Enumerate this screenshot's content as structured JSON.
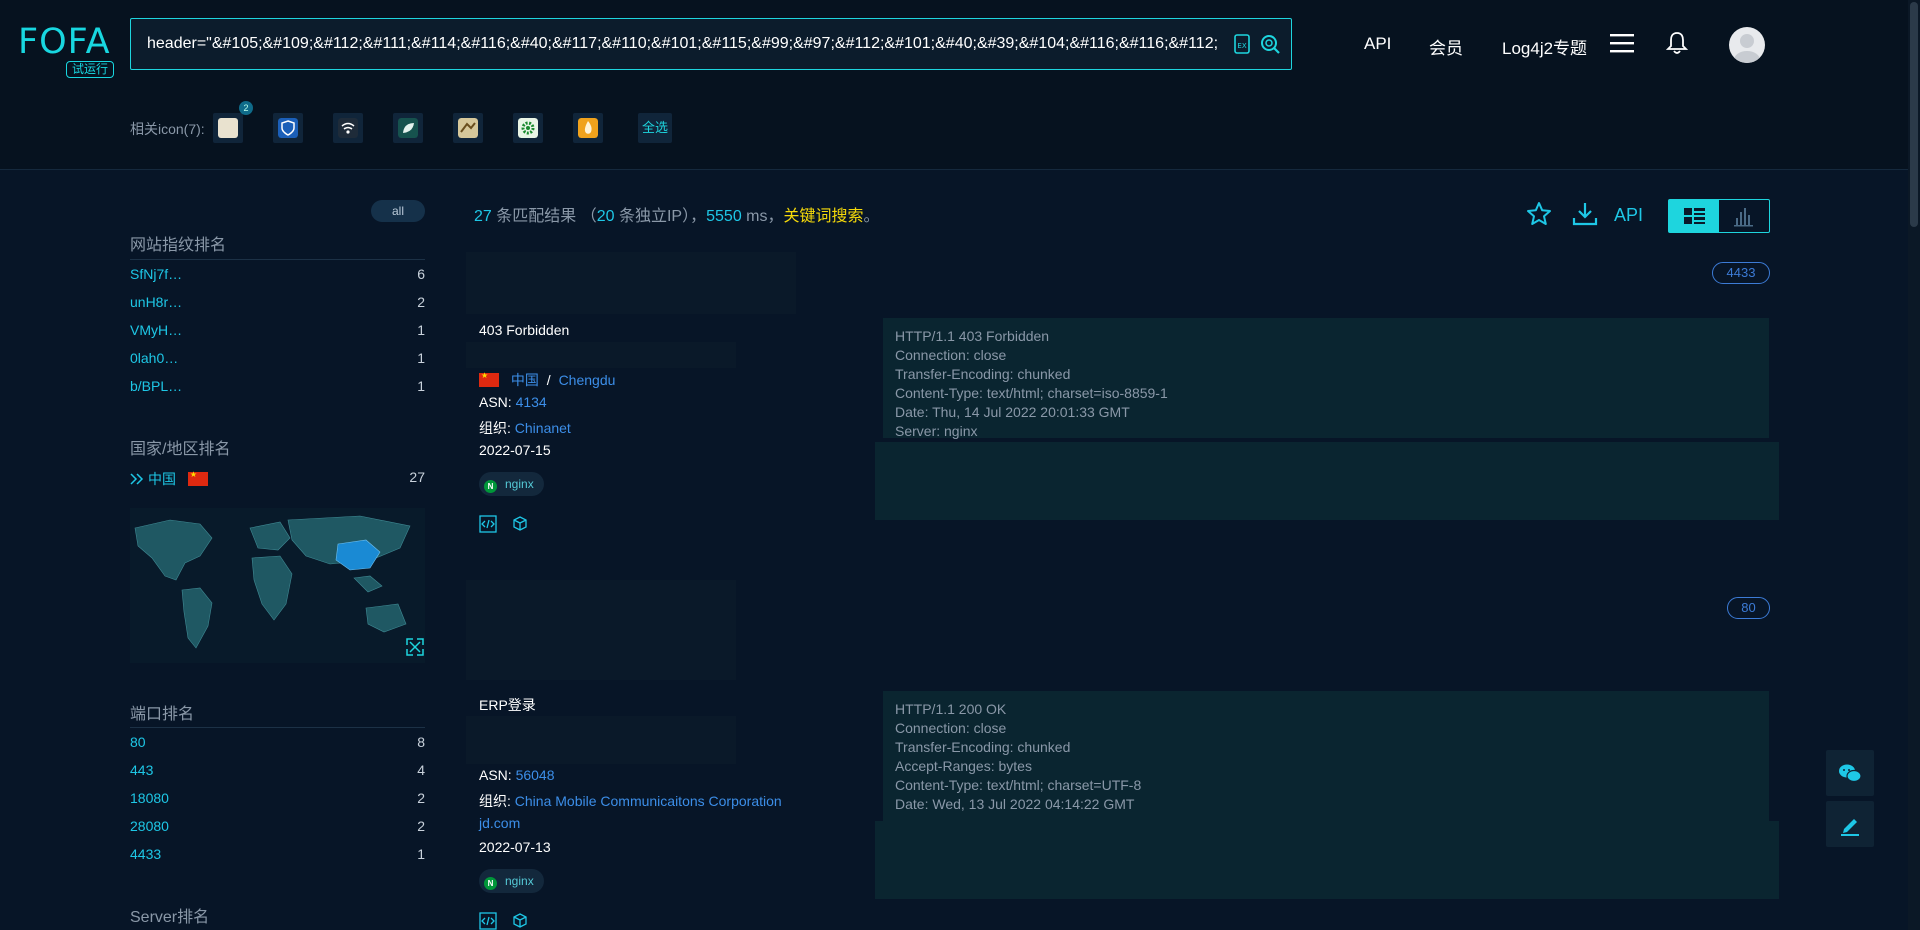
{
  "brand": {
    "name": "FOFA",
    "badge": "试运行"
  },
  "search": {
    "query": "header=\"&#105;&#109;&#112;&#111;&#114;&#116;&#40;&#117;&#110;&#101;&#115;&#99;&#97;&#112;&#101;&#40;&#39;&#104;&#116;&#116;&#112;\""
  },
  "nav": {
    "api": "API",
    "member": "会员",
    "topic": "Log4j2专题"
  },
  "related_icons": {
    "label": "相关icon(7):",
    "first_badge": "2",
    "select_all": "全选",
    "icons": [
      "pmsa-icon",
      "shield-app-icon",
      "router-icon",
      "leaf-app-icon",
      "camera-app-icon",
      "gear-green-icon",
      "fire-app-icon"
    ]
  },
  "sidebar": {
    "all_label": "all",
    "fingerprint": {
      "title": "网站指纹排名",
      "items": [
        {
          "name": "SfNj7f…",
          "count": "6"
        },
        {
          "name": "unH8r…",
          "count": "2"
        },
        {
          "name": "VMyH…",
          "count": "1"
        },
        {
          "name": "0lah0…",
          "count": "1"
        },
        {
          "name": "b/BPL…",
          "count": "1"
        }
      ]
    },
    "country": {
      "title": "国家/地区排名",
      "name": "中国",
      "count": "27"
    },
    "port": {
      "title": "端口排名",
      "items": [
        {
          "name": "80",
          "count": "8"
        },
        {
          "name": "443",
          "count": "4"
        },
        {
          "name": "18080",
          "count": "2"
        },
        {
          "name": "28080",
          "count": "2"
        },
        {
          "name": "4433",
          "count": "1"
        }
      ]
    },
    "server": {
      "title": "Server排名"
    }
  },
  "summary": {
    "results": "27",
    "results_label": "条匹配结果",
    "paren_open": "（",
    "ips": "20",
    "ips_label": "条独立IP）",
    "sep": "，",
    "ms": "5550",
    "ms_label": "ms，",
    "keyword": "关键词搜索",
    "end": "。"
  },
  "toolbar": {
    "api_label": "API"
  },
  "results": [
    {
      "port": "4433",
      "title": "403 Forbidden",
      "country": "中国",
      "slash": "/",
      "city": "Chengdu",
      "asn_label": "ASN:",
      "asn": "4134",
      "org_label": "组织:",
      "org": "Chinanet",
      "date": "2022-07-15",
      "tag": "nginx",
      "response": "HTTP/1.1 403 Forbidden\nConnection: close\nTransfer-Encoding: chunked\nContent-Type: text/html; charset=iso-8859-1\nDate: Thu, 14 Jul 2022 20:01:33 GMT\nServer: nginx"
    },
    {
      "port": "80",
      "title": "ERP登录",
      "asn_label": "ASN:",
      "asn": "56048",
      "org_label": "组织:",
      "org": "China Mobile Communicaitons Corporation",
      "domain": "jd.com",
      "date": "2022-07-13",
      "tag": "nginx",
      "response": "HTTP/1.1 200 OK\nConnection: close\nTransfer-Encoding: chunked\nAccept-Ranges: bytes\nContent-Type: text/html; charset=UTF-8\nDate: Wed, 13 Jul 2022 04:14:22 GMT"
    }
  ],
  "colors": {
    "accent": "#1ed5de",
    "link": "#3c8ee8",
    "keyword": "#f5d90a",
    "background": "#071527"
  }
}
